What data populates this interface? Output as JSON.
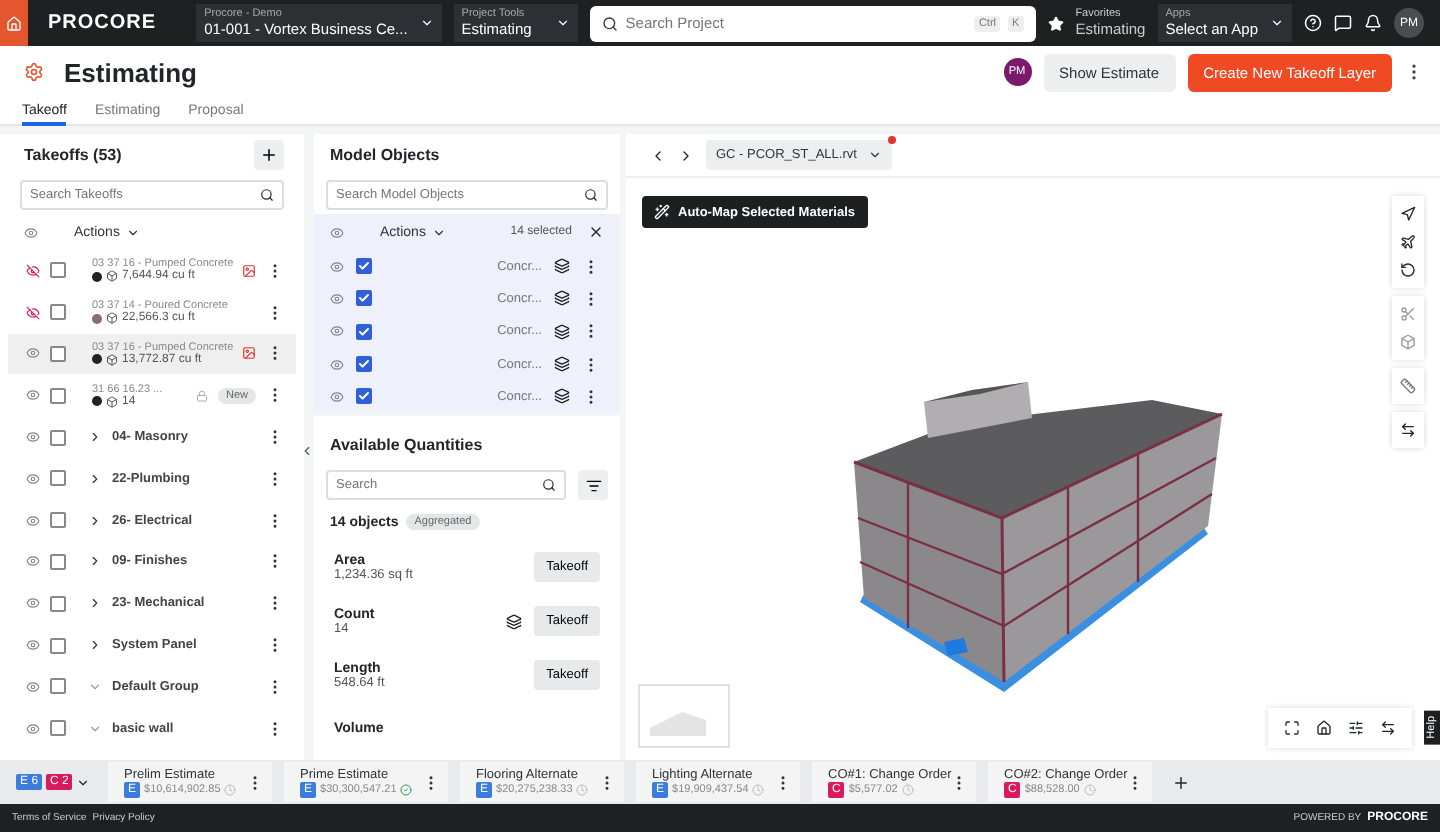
{
  "topbar": {
    "brand": "PROCORE",
    "project": {
      "label": "Procore - Demo",
      "value": "01-001 - Vortex Business Ce..."
    },
    "tools": {
      "label": "Project Tools",
      "value": "Estimating"
    },
    "search": {
      "placeholder": "Search Project",
      "keys": [
        "Ctrl",
        "K"
      ]
    },
    "favorites": {
      "label": "Favorites",
      "value": "Estimating"
    },
    "apps": {
      "label": "Apps",
      "value": "Select an App"
    },
    "avatar": "PM"
  },
  "header": {
    "title": "Estimating",
    "avatar": "PM",
    "secondary_button": "Show Estimate",
    "primary_button": "Create New Takeoff Layer"
  },
  "tabs": [
    {
      "label": "Takeoff",
      "selected": true
    },
    {
      "label": "Estimating",
      "selected": false
    },
    {
      "label": "Proposal",
      "selected": false
    }
  ],
  "takeoffs": {
    "title": "Takeoffs (53)",
    "search_placeholder": "Search Takeoffs",
    "actions": "Actions",
    "items": [
      {
        "kind": "takeoff",
        "code": "03 37 16 - Pumped Concrete",
        "quantity": "7,644.94 cu ft",
        "color": "#222222",
        "visible": false,
        "checked": false,
        "selected": false,
        "flag": true
      },
      {
        "kind": "takeoff",
        "code": "03 37 14 - Poured Concrete",
        "quantity": "22,566.3 cu ft",
        "color": "#8a6b78",
        "visible": false,
        "checked": false,
        "selected": false,
        "flag": false
      },
      {
        "kind": "takeoff",
        "code": "03 37 16 - Pumped Concrete",
        "quantity": "13,772.87 cu ft",
        "color": "#222222",
        "visible": true,
        "checked": false,
        "selected": true,
        "flag": true
      },
      {
        "kind": "takeoff",
        "code": "31 66 16.23 ...",
        "quantity": "14",
        "color": "#222222",
        "visible": true,
        "checked": false,
        "selected": false,
        "flag": false,
        "tag": "New"
      },
      {
        "kind": "group",
        "label": "04- Masonry",
        "visible": true,
        "checked": false,
        "expanded": false
      },
      {
        "kind": "group",
        "label": "22-Plumbing",
        "visible": true,
        "checked": false,
        "expanded": false
      },
      {
        "kind": "group",
        "label": "26- Electrical",
        "visible": true,
        "checked": false,
        "expanded": false
      },
      {
        "kind": "group",
        "label": "09- Finishes",
        "visible": true,
        "checked": false,
        "expanded": false
      },
      {
        "kind": "group",
        "label": "23- Mechanical",
        "visible": true,
        "checked": false,
        "expanded": false
      },
      {
        "kind": "group",
        "label": "System Panel",
        "visible": true,
        "checked": false,
        "expanded": false
      },
      {
        "kind": "group",
        "label": "Default Group",
        "visible": true,
        "checked": false,
        "expanded": true
      },
      {
        "kind": "group",
        "label": "basic wall",
        "visible": true,
        "checked": false,
        "expanded": true
      }
    ]
  },
  "model_objects": {
    "title": "Model Objects",
    "search_placeholder": "Search Model Objects",
    "actions": "Actions",
    "selected_count": "14 selected",
    "rows": [
      {
        "label": "Concr...",
        "checked": true
      },
      {
        "label": "Concr...",
        "checked": true
      },
      {
        "label": "Concr...",
        "checked": true
      },
      {
        "label": "Concr...",
        "checked": true
      },
      {
        "label": "Concr...",
        "checked": true
      }
    ]
  },
  "available_quantities": {
    "title": "Available Quantities",
    "search_placeholder": "Search",
    "count": "14 objects",
    "tag": "Aggregated",
    "rows": [
      {
        "name": "Area",
        "value": "1,234.36 sq ft",
        "button": "Takeoff",
        "layered": false
      },
      {
        "name": "Count",
        "value": "14",
        "button": "Takeoff",
        "layered": true
      },
      {
        "name": "Length",
        "value": "548.64 ft",
        "button": "Takeoff",
        "layered": false
      },
      {
        "name": "Volume",
        "layered": false
      }
    ]
  },
  "viewer": {
    "file": "GC - PCOR_ST_ALL.rvt",
    "automap_button": "Auto-Map Selected Materials",
    "help": "Help"
  },
  "estimates": {
    "counts": [
      {
        "letter": "E",
        "count": "6",
        "color": "#3b7ddd"
      },
      {
        "letter": "C",
        "count": "2",
        "color": "#d81b60"
      }
    ],
    "tabs": [
      {
        "name": "Prelim Estimate",
        "letter": "E",
        "color": "#3b7ddd",
        "amount": "$10,614,902.85",
        "complete": false
      },
      {
        "name": "Prime Estimate",
        "letter": "E",
        "color": "#3b7ddd",
        "amount": "$30,300,547.21",
        "complete": true
      },
      {
        "name": "Flooring Alternate",
        "letter": "E",
        "color": "#3b7ddd",
        "amount": "$20,275,238.33",
        "complete": false
      },
      {
        "name": "Lighting Alternate",
        "letter": "E",
        "color": "#3b7ddd",
        "amount": "$19,909,437.54",
        "complete": false
      },
      {
        "name": "CO#1: Change Order",
        "letter": "C",
        "color": "#d81b60",
        "amount": "$5,577.02",
        "complete": false
      },
      {
        "name": "CO#2: Change Order",
        "letter": "C",
        "color": "#d81b60",
        "amount": "$88,528.00",
        "complete": false
      }
    ]
  },
  "footer": {
    "links": [
      "Terms of Service",
      "Privacy Policy"
    ],
    "powered": "POWERED BY",
    "brand": "PROCORE"
  }
}
